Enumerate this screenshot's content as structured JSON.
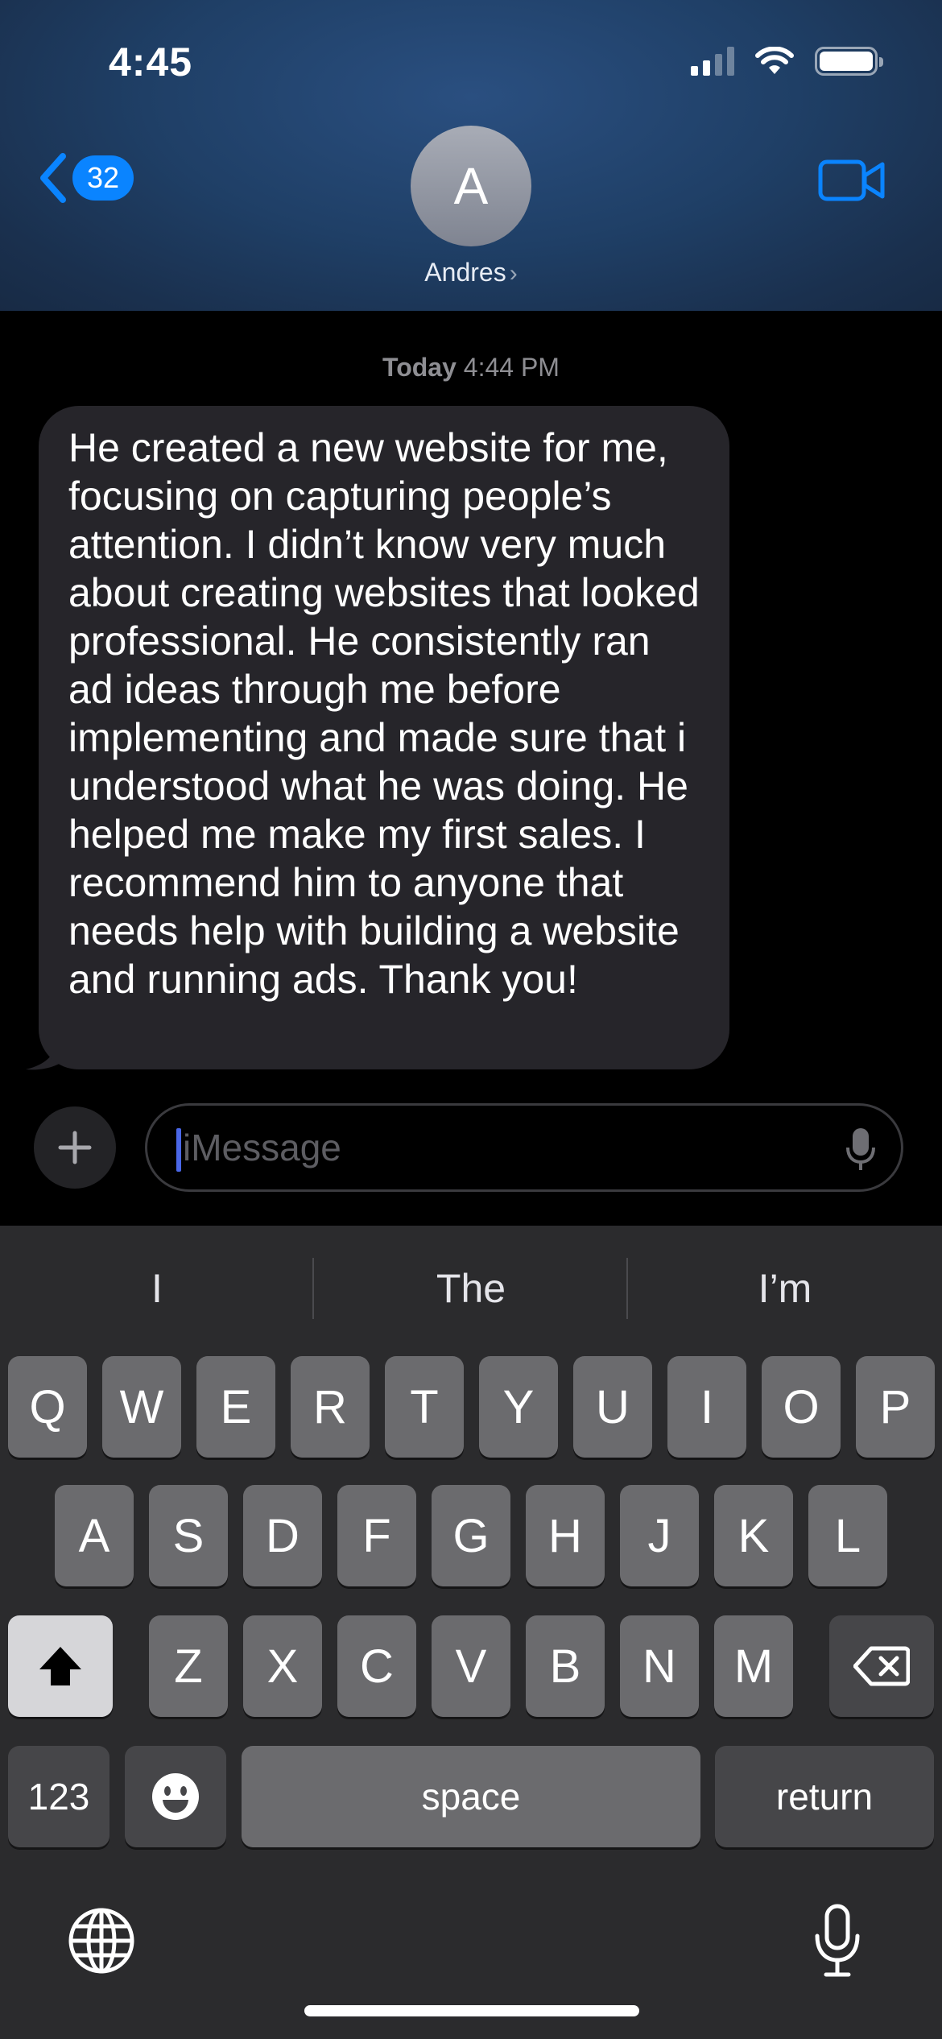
{
  "status_bar": {
    "time": "4:45"
  },
  "header": {
    "back_badge": "32",
    "avatar_initial": "A",
    "contact_name": "Andres",
    "chevron": "›"
  },
  "conversation": {
    "timestamp_day": "Today",
    "timestamp_time": "4:44 PM",
    "messages": [
      {
        "direction": "incoming",
        "text": "He created a new website for me, focusing on capturing people’s attention. I didn’t know very much about creating websites that looked professional. He consistently ran ad ideas through me before implementing and made sure that i understood what he was doing. He helped me make my first sales. I recommend him to anyone that needs help with building a website and running ads. Thank you!"
      }
    ]
  },
  "input": {
    "placeholder": "iMessage",
    "value": ""
  },
  "keyboard": {
    "suggestions": [
      "I",
      "The",
      "I’m"
    ],
    "row1": [
      "Q",
      "W",
      "E",
      "R",
      "T",
      "Y",
      "U",
      "I",
      "O",
      "P"
    ],
    "row2": [
      "A",
      "S",
      "D",
      "F",
      "G",
      "H",
      "J",
      "K",
      "L"
    ],
    "row3": [
      "Z",
      "X",
      "C",
      "V",
      "B",
      "N",
      "M"
    ],
    "numbers_label": "123",
    "space_label": "space",
    "return_label": "return"
  },
  "colors": {
    "accent": "#0a84ff",
    "bubble_incoming": "#26252a",
    "keyboard_bg": "#2b2b2d",
    "key_bg": "#6b6b6e"
  },
  "icons": {
    "back": "chevron-left-icon",
    "video": "video-camera-icon",
    "plus": "plus-icon",
    "dictation": "microphone-icon",
    "shift": "shift-icon",
    "delete": "delete-backspace-icon",
    "emoji": "emoji-icon",
    "globe": "globe-icon",
    "keyboard_mic": "microphone-icon"
  }
}
